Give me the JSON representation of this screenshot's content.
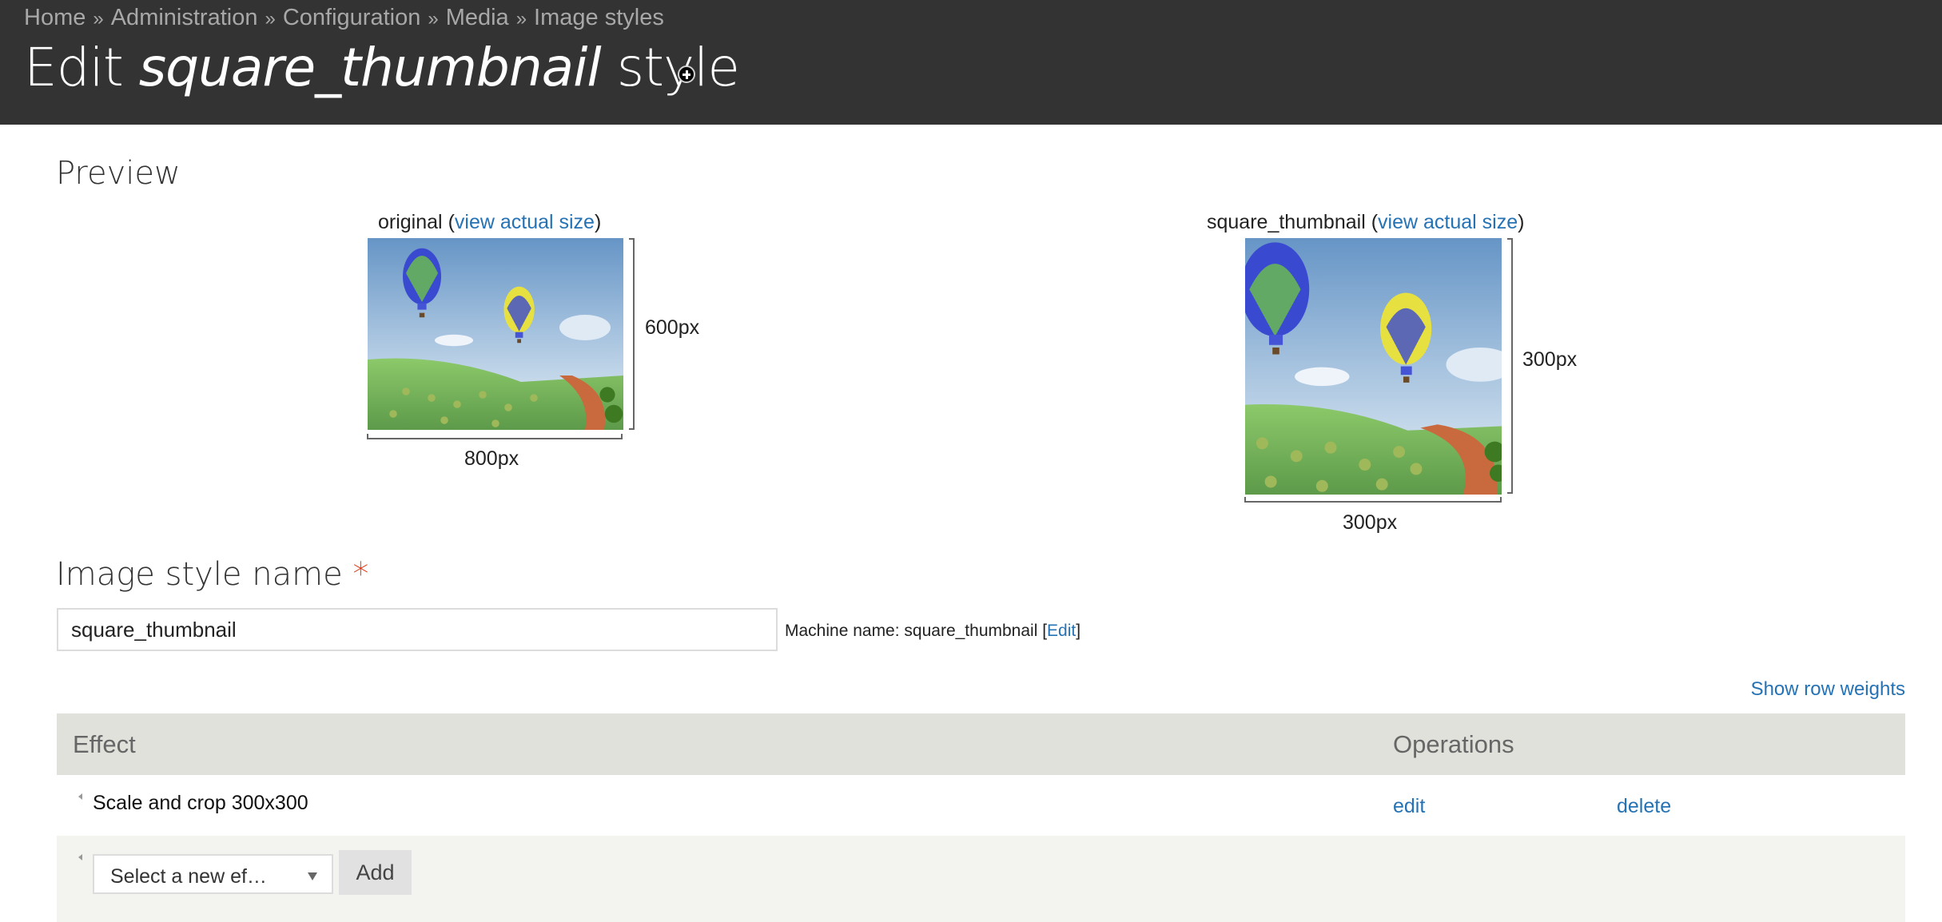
{
  "header": {
    "breadcrumb": [
      "Home",
      "Administration",
      "Configuration",
      "Media",
      "Image styles"
    ],
    "breadcrumb_separator": "»",
    "title_prefix": "Edit",
    "title_style": "square_thumbnail",
    "title_suffix": "style",
    "shortcut_icon": "add-shortcut-icon"
  },
  "preview": {
    "heading": "Preview",
    "original": {
      "label": "original",
      "link": "view actual size",
      "width_label": "800px",
      "height_label": "600px"
    },
    "derivative": {
      "label": "square_thumbnail",
      "link": "view actual size",
      "width_label": "300px",
      "height_label": "300px"
    },
    "open_paren": "(",
    "close_paren": ")"
  },
  "form": {
    "name_label": "Image style name",
    "required_marker": "*",
    "name_value": "square_thumbnail",
    "machine_name_prefix": "Machine name: square_thumbnail [",
    "machine_name_edit": "Edit",
    "machine_name_suffix": "]"
  },
  "effects": {
    "show_row_weights": "Show row weights",
    "columns": [
      "Effect",
      "Operations"
    ],
    "rows": [
      {
        "effect": "Scale and crop 300x300",
        "operations": [
          "edit",
          "delete"
        ]
      }
    ],
    "new_effect_select": "Select a new ef…",
    "add_button": "Add"
  },
  "colors": {
    "header_bg": "#333333",
    "link": "#2572b4",
    "required": "#e32700",
    "table_header_bg": "#e1e1dc",
    "add_row_bg": "#f3f3ef"
  }
}
